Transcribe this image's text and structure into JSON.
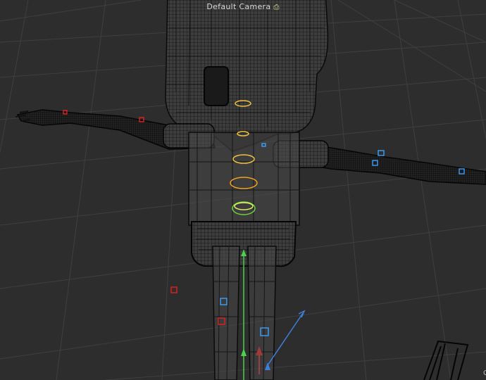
{
  "viewport": {
    "camera_label": "Default Camera",
    "camera_icon": "camera-icon",
    "corner_text": "C"
  },
  "colors": {
    "background": "#2d2d2d",
    "grid": "#3f3f3f",
    "wire": "#0a0a0a",
    "body_fill": "#4a4a4a",
    "y_axis": "#4fd04f",
    "z_axis": "#3f7fd8",
    "x_axis": "#c04040",
    "ctrl_yellow": "#f0c040",
    "ctrl_orange": "#f0a020",
    "ctrl_green": "#70d040",
    "joint_blue": "#3aa0ff",
    "joint_red": "#e02020"
  },
  "scene": {
    "object": "character-rig-wireframe",
    "view": "perspective"
  }
}
